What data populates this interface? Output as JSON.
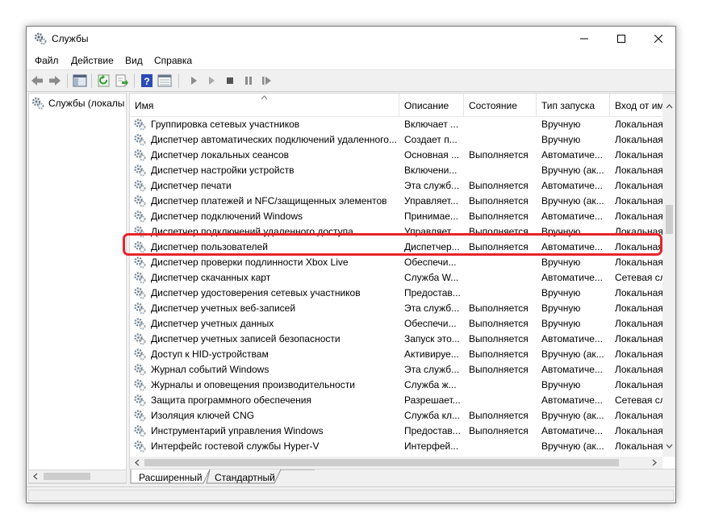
{
  "window": {
    "title": "Службы"
  },
  "menu": [
    "Файл",
    "Действие",
    "Вид",
    "Справка"
  ],
  "tree": {
    "root_label": "Службы (локалы"
  },
  "columns": [
    "Имя",
    "Описание",
    "Состояние",
    "Тип запуска",
    "Вход от им"
  ],
  "rows": [
    {
      "name": "Группировка сетевых участников",
      "desc": "Включает ...",
      "state": "",
      "startup": "Вручную",
      "logon": "Локальная"
    },
    {
      "name": "Диспетчер автоматических подключений удаленного...",
      "desc": "Создает п...",
      "state": "",
      "startup": "Вручную",
      "logon": "Локальная"
    },
    {
      "name": "Диспетчер локальных сеансов",
      "desc": "Основная ...",
      "state": "Выполняется",
      "startup": "Автоматиче...",
      "logon": "Локальная"
    },
    {
      "name": "Диспетчер настройки устройств",
      "desc": "Включени...",
      "state": "",
      "startup": "Вручную (ак...",
      "logon": "Локальная"
    },
    {
      "name": "Диспетчер печати",
      "desc": "Эта служб...",
      "state": "Выполняется",
      "startup": "Автоматиче...",
      "logon": "Локальная"
    },
    {
      "name": "Диспетчер платежей и NFC/защищенных элементов",
      "desc": "Управляет...",
      "state": "Выполняется",
      "startup": "Вручную (ак...",
      "logon": "Локальная"
    },
    {
      "name": "Диспетчер подключений Windows",
      "desc": "Принимае...",
      "state": "Выполняется",
      "startup": "Автоматиче...",
      "logon": "Локальная"
    },
    {
      "name": "Диспетчер подключений удаленного доступа",
      "desc": "Управляет...",
      "state": "Выполняется",
      "startup": "Вручную",
      "logon": "Локальная"
    },
    {
      "name": "Диспетчер пользователей",
      "desc": "Диспетчер...",
      "state": "Выполняется",
      "startup": "Автоматиче...",
      "logon": "Локальная"
    },
    {
      "name": "Диспетчер проверки подлинности Xbox Live",
      "desc": "Обеспечи...",
      "state": "",
      "startup": "Вручную",
      "logon": "Локальная"
    },
    {
      "name": "Диспетчер скачанных карт",
      "desc": "Служба W...",
      "state": "",
      "startup": "Автоматиче...",
      "logon": "Сетевая сл"
    },
    {
      "name": "Диспетчер удостоверения сетевых участников",
      "desc": "Предостав...",
      "state": "",
      "startup": "Вручную",
      "logon": "Локальная"
    },
    {
      "name": "Диспетчер учетных веб-записей",
      "desc": "Эта служб...",
      "state": "Выполняется",
      "startup": "Вручную",
      "logon": "Локальная"
    },
    {
      "name": "Диспетчер учетных данных",
      "desc": "Обеспечи...",
      "state": "Выполняется",
      "startup": "Вручную",
      "logon": "Локальная"
    },
    {
      "name": "Диспетчер учетных записей безопасности",
      "desc": "Запуск это...",
      "state": "Выполняется",
      "startup": "Автоматиче...",
      "logon": "Локальная"
    },
    {
      "name": "Доступ к HID-устройствам",
      "desc": "Активируе...",
      "state": "Выполняется",
      "startup": "Вручную (ак...",
      "logon": "Локальная"
    },
    {
      "name": "Журнал событий Windows",
      "desc": "Эта служб...",
      "state": "Выполняется",
      "startup": "Автоматиче...",
      "logon": "Локальная"
    },
    {
      "name": "Журналы и оповещения производительности",
      "desc": "Служба ж...",
      "state": "",
      "startup": "Вручную",
      "logon": "Локальная"
    },
    {
      "name": "Защита программного обеспечения",
      "desc": "Разрешает...",
      "state": "",
      "startup": "Автоматиче...",
      "logon": "Сетевая сл"
    },
    {
      "name": "Изоляция ключей CNG",
      "desc": "Служба кл...",
      "state": "Выполняется",
      "startup": "Вручную (ак...",
      "logon": "Локальная"
    },
    {
      "name": "Инструментарий управления Windows",
      "desc": "Предостав...",
      "state": "Выполняется",
      "startup": "Автоматиче...",
      "logon": "Локальная"
    },
    {
      "name": "Интерфейс гостевой службы Hyper-V",
      "desc": "Интерфей...",
      "state": "",
      "startup": "Вручную (ак...",
      "logon": "Локальная"
    }
  ],
  "highlighted_row_index": 8,
  "tabs": [
    "Расширенный",
    "Стандартный"
  ],
  "colors": {
    "highlight": "#e8232a",
    "help_icon": "#2a4bb6",
    "refresh_icon": "#2f9e2f"
  }
}
